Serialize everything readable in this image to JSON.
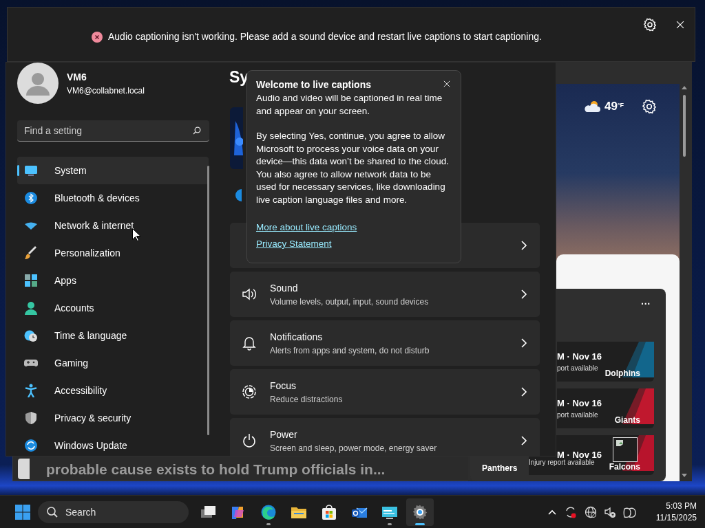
{
  "caption_bar": {
    "message": "Audio captioning isn't working. Please add a sound device and restart live captions to start captioning."
  },
  "browser": {
    "headline": "probable cause exists  to hold Trump officials in..."
  },
  "widgets": {
    "temperature": "49$^{°F}$",
    "more": "···",
    "games": [
      {
        "time": "M · Nov 16",
        "note": "port available",
        "team": "Dolphins",
        "color": "#12668c",
        "broken_image": false
      },
      {
        "time": "M · Nov 16",
        "note": "port available",
        "team": "Giants",
        "color": "#c0182e",
        "broken_image": false
      },
      {
        "time": "M · Nov 16",
        "note": "Injury report available",
        "away": "Panthers",
        "team": "Falcons",
        "color": "#b8142c",
        "broken_image": true
      }
    ]
  },
  "settings": {
    "user": {
      "name": "VM6",
      "email": "VM6@collabnet.local"
    },
    "search": {
      "placeholder": "Find a setting"
    },
    "nav": [
      {
        "label": "System",
        "kind": "system",
        "selected": true
      },
      {
        "label": "Bluetooth & devices",
        "kind": "bluetooth",
        "selected": false
      },
      {
        "label": "Network & internet",
        "kind": "network",
        "selected": false
      },
      {
        "label": "Personalization",
        "kind": "brush",
        "selected": false
      },
      {
        "label": "Apps",
        "kind": "apps",
        "selected": false
      },
      {
        "label": "Accounts",
        "kind": "person",
        "selected": false
      },
      {
        "label": "Time & language",
        "kind": "clock",
        "selected": false
      },
      {
        "label": "Gaming",
        "kind": "gamepad",
        "selected": false
      },
      {
        "label": "Accessibility",
        "kind": "accessibility",
        "selected": false
      },
      {
        "label": "Privacy & security",
        "kind": "shield",
        "selected": false
      },
      {
        "label": "Windows Update",
        "kind": "update",
        "selected": false
      }
    ],
    "title": "Sy",
    "rows": [
      {
        "kind": "sound",
        "title": "Sound",
        "subtitle": "Volume levels, output, input, sound devices"
      },
      {
        "kind": "bell",
        "title": "Notifications",
        "subtitle": "Alerts from apps and system, do not disturb"
      },
      {
        "kind": "focus",
        "title": "Focus",
        "subtitle": "Reduce distractions"
      },
      {
        "kind": "power",
        "title": "Power",
        "subtitle": "Screen and sleep, power mode, energy saver"
      }
    ]
  },
  "flyout": {
    "title": "Welcome to live captions",
    "paragraphs": [
      "Audio and video will be captioned in real time and appear on your screen.",
      "By selecting Yes, continue, you agree to allow Microsoft to process your voice data on your device—this data won’t be shared to the cloud. You also agree to allow network data to be used for necessary services, like downloading live caption language files and more."
    ],
    "links": [
      "More about live captions",
      "Privacy Statement"
    ]
  },
  "taskbar": {
    "search": {
      "placeholder": "Search"
    },
    "apps": [
      {
        "kind": "task-view",
        "running": false,
        "active": false
      },
      {
        "kind": "copilot",
        "running": false,
        "active": false
      },
      {
        "kind": "edge",
        "running": true,
        "active": false
      },
      {
        "kind": "folder",
        "running": false,
        "active": false
      },
      {
        "kind": "store",
        "running": false,
        "active": false
      },
      {
        "kind": "mail",
        "running": false,
        "active": false
      },
      {
        "kind": "remote",
        "running": true,
        "active": false
      },
      {
        "kind": "gear",
        "running": true,
        "active": true
      }
    ],
    "time": "5:03 PM",
    "date": "11/15/2025"
  }
}
